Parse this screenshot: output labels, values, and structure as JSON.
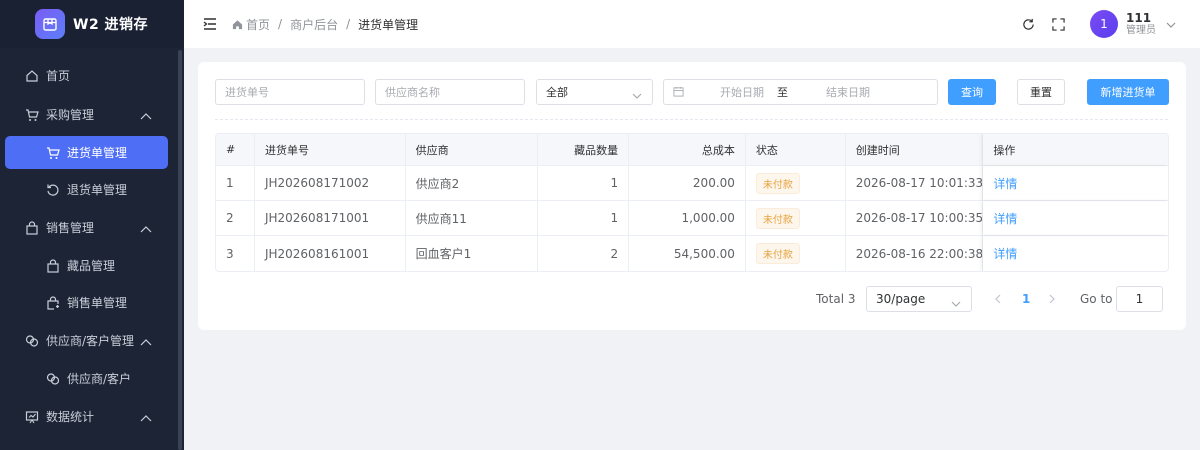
{
  "app": {
    "brand_title": "W2 进销存"
  },
  "sidebar": {
    "items": [
      {
        "label": "首页",
        "icon": "home-icon"
      },
      {
        "label": "采购管理",
        "icon": "cart-icon",
        "expanded": true,
        "children": [
          {
            "label": "进货单管理",
            "icon": "cart-icon",
            "active": true
          },
          {
            "label": "退货单管理",
            "icon": "return-icon"
          }
        ]
      },
      {
        "label": "销售管理",
        "icon": "bag-icon",
        "expanded": true,
        "children": [
          {
            "label": "藏品管理",
            "icon": "bag-icon"
          },
          {
            "label": "销售单管理",
            "icon": "bag-edit-icon"
          }
        ]
      },
      {
        "label": "供应商/客户管理",
        "icon": "link-icon",
        "expanded": true,
        "children": [
          {
            "label": "供应商/客户",
            "icon": "link-icon"
          }
        ]
      },
      {
        "label": "数据统计",
        "icon": "chart-icon",
        "expanded": true
      }
    ]
  },
  "header": {
    "breadcrumb": [
      "首页",
      "商户后台",
      "进货单管理"
    ],
    "user": {
      "avatar": "1",
      "name": "111",
      "role": "管理员"
    }
  },
  "filters": {
    "order_no_placeholder": "进货单号",
    "supplier_placeholder": "供应商名称",
    "status_value": "全部",
    "start_date_placeholder": "开始日期",
    "range_sep": "至",
    "end_date_placeholder": "结束日期",
    "query_label": "查询",
    "reset_label": "重置",
    "add_label": "新增进货单"
  },
  "table": {
    "columns": [
      "#",
      "进货单号",
      "供应商",
      "藏品数量",
      "总成本",
      "状态",
      "创建时间",
      "操作"
    ],
    "rows": [
      {
        "idx": "1",
        "no": "JH202608171002",
        "supplier": "供应商2",
        "qty": "1",
        "cost": "200.00",
        "status": "未付款",
        "time": "2026-08-17 10:01:33",
        "op": "详情"
      },
      {
        "idx": "2",
        "no": "JH202608171001",
        "supplier": "供应商11",
        "qty": "1",
        "cost": "1,000.00",
        "status": "未付款",
        "time": "2026-08-17 10:00:35",
        "op": "详情"
      },
      {
        "idx": "3",
        "no": "JH202608161001",
        "supplier": "回血客户1",
        "qty": "2",
        "cost": "54,500.00",
        "status": "未付款",
        "time": "2026-08-16 22:00:38",
        "op": "详情"
      }
    ]
  },
  "pager": {
    "total": "Total 3",
    "page_size": "30/page",
    "current": "1",
    "goto_label": "Go to",
    "goto_value": "1"
  },
  "colors": {
    "primary": "#409eff",
    "sidebar_bg": "#1c2436",
    "active_menu": "#4f6ef6",
    "tag_warning": "#e6a23c"
  }
}
